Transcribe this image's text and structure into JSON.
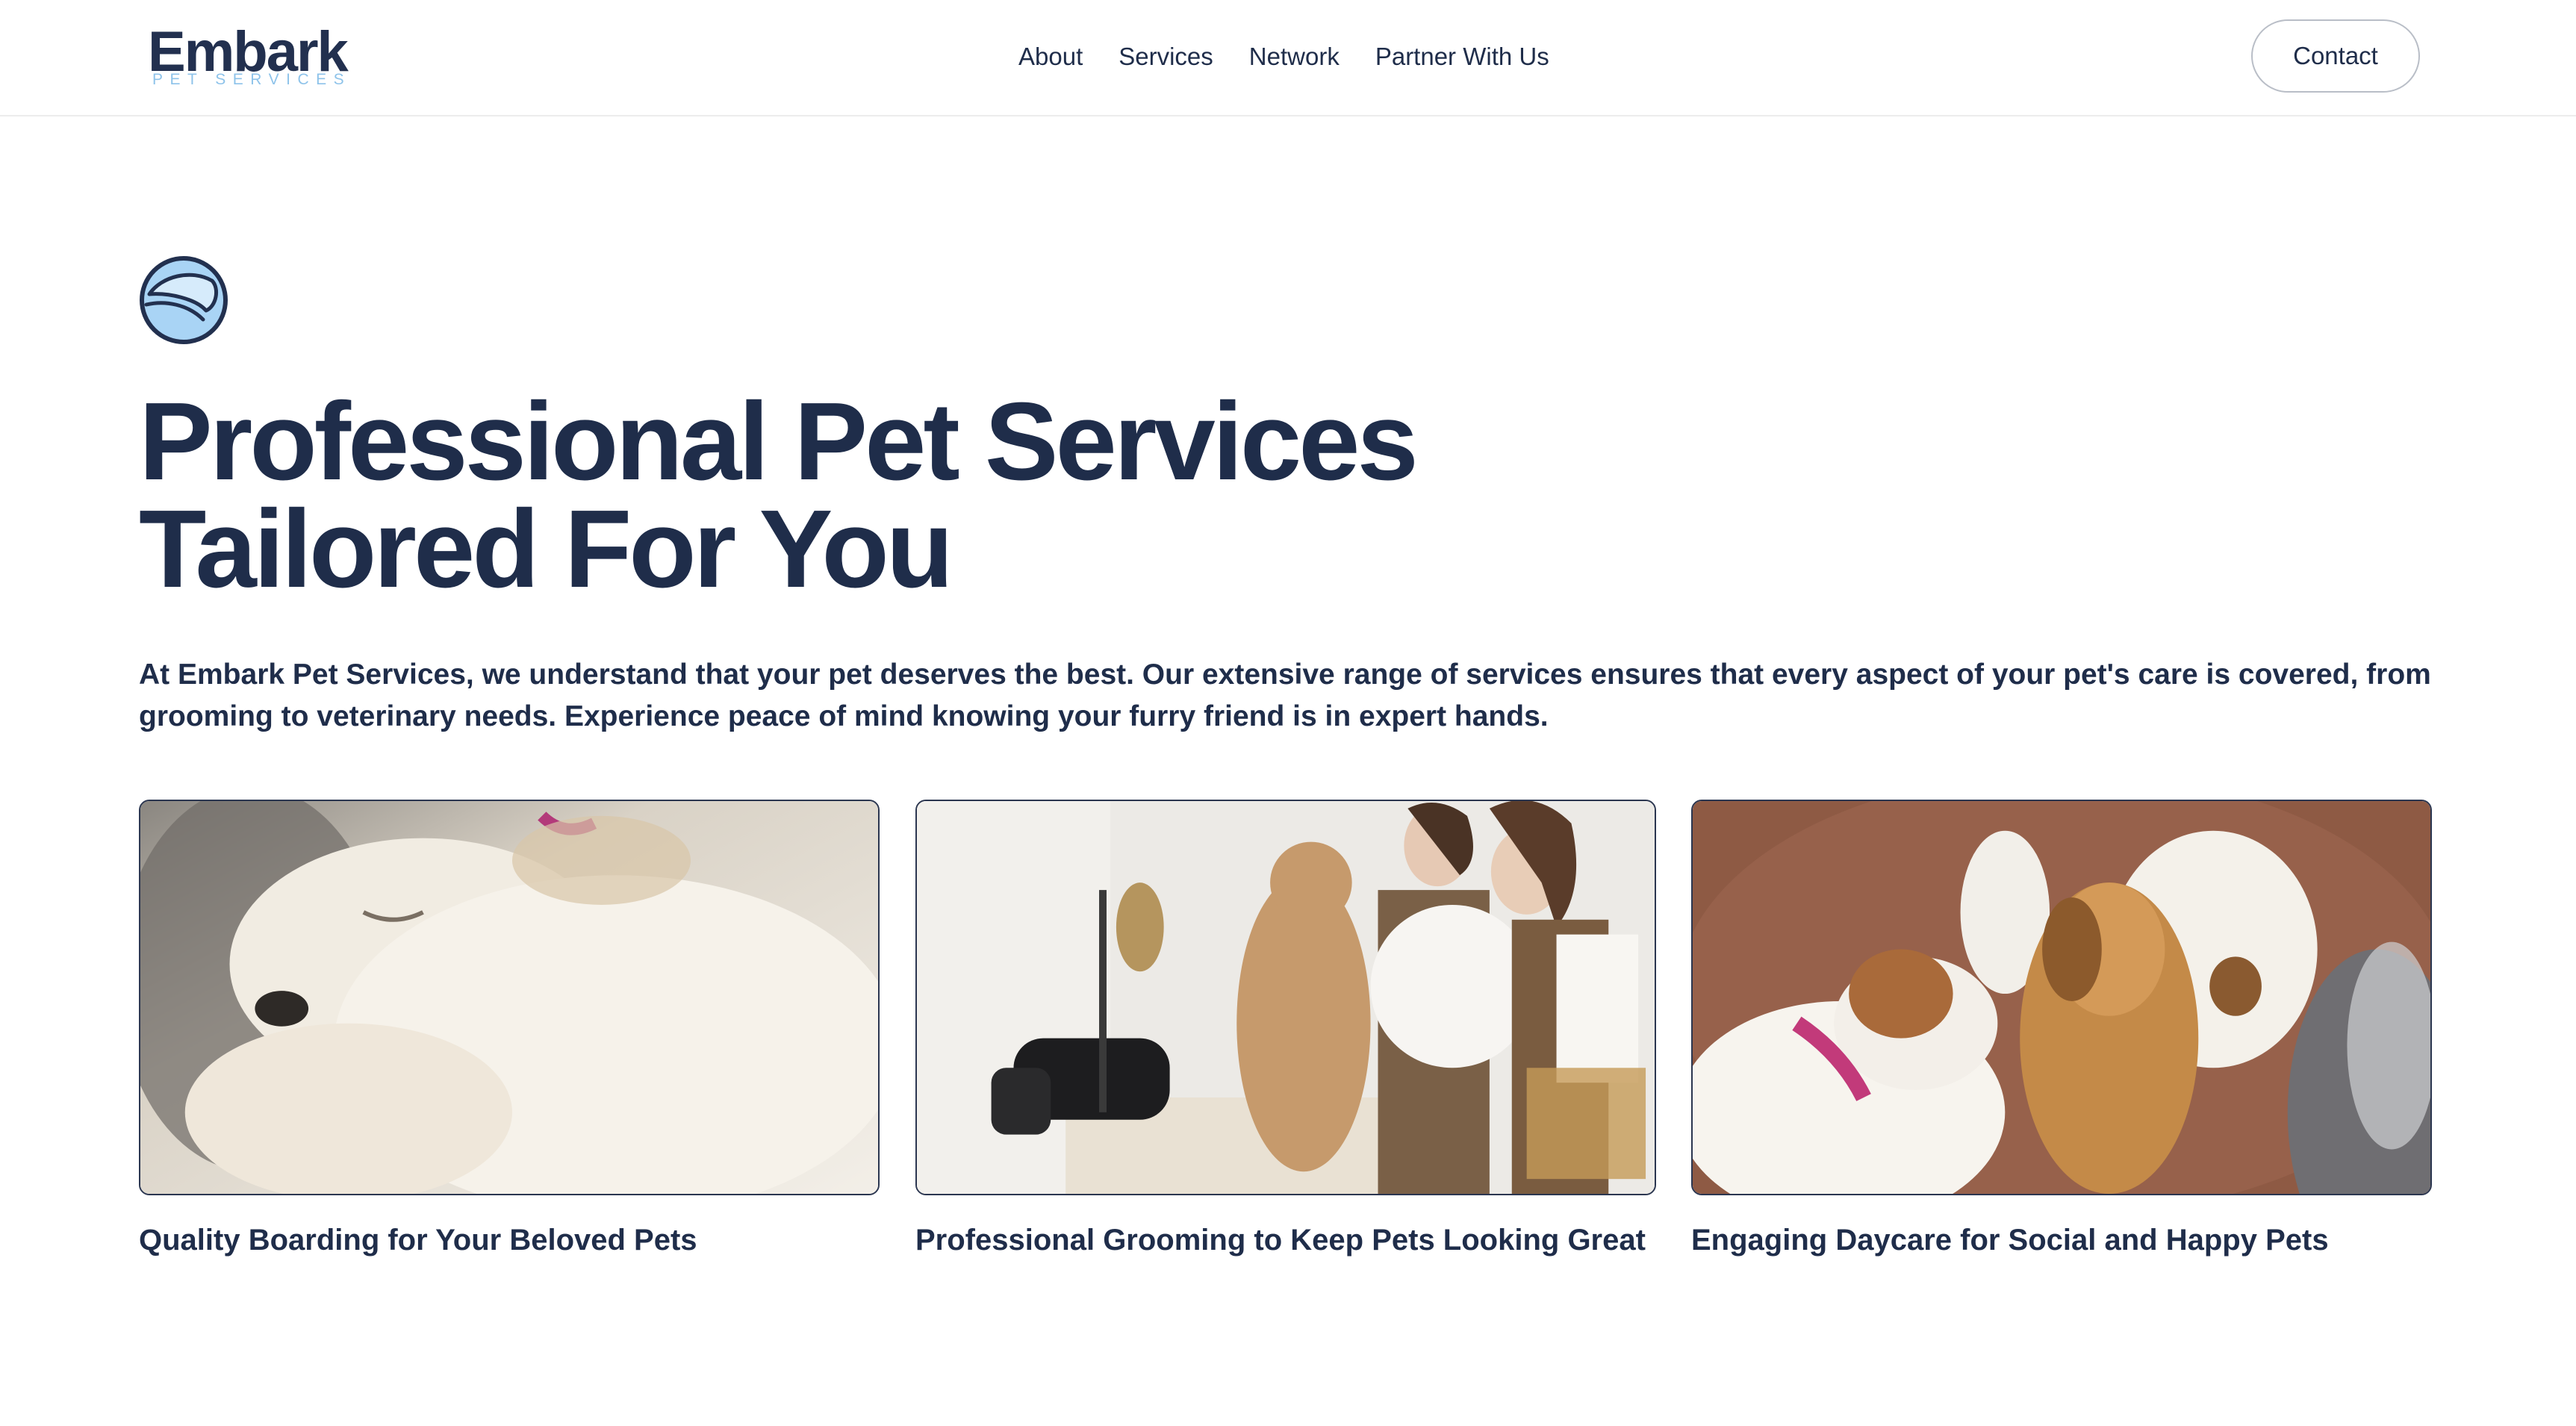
{
  "brand": {
    "name": "Embark",
    "tagline": "PET SERVICES"
  },
  "nav": {
    "items": [
      "About",
      "Services",
      "Network",
      "Partner With Us"
    ],
    "contact_label": "Contact"
  },
  "hero": {
    "title_line1": "Professional Pet Services",
    "title_line2": "Tailored For You",
    "description": "At Embark Pet Services, we understand that your pet deserves the best. Our extensive range of services ensures that every aspect of your pet's care is covered, from grooming to veterinary needs. Experience peace of mind knowing your furry friend is in expert hands.",
    "icon": "tennis-ball-icon"
  },
  "services": [
    {
      "caption": "Quality Boarding for Your Beloved Pets",
      "image": "sleeping-dog-photo"
    },
    {
      "caption": "Professional Grooming to Keep Pets Looking Great",
      "image": "grooming-poodle-photo"
    },
    {
      "caption": "Engaging Daycare for Social and Happy Pets",
      "image": "dogs-playing-photo"
    }
  ],
  "colors": {
    "primary": "#1f2d4a",
    "accent": "#8ec3ea",
    "border": "#b9bec7"
  }
}
